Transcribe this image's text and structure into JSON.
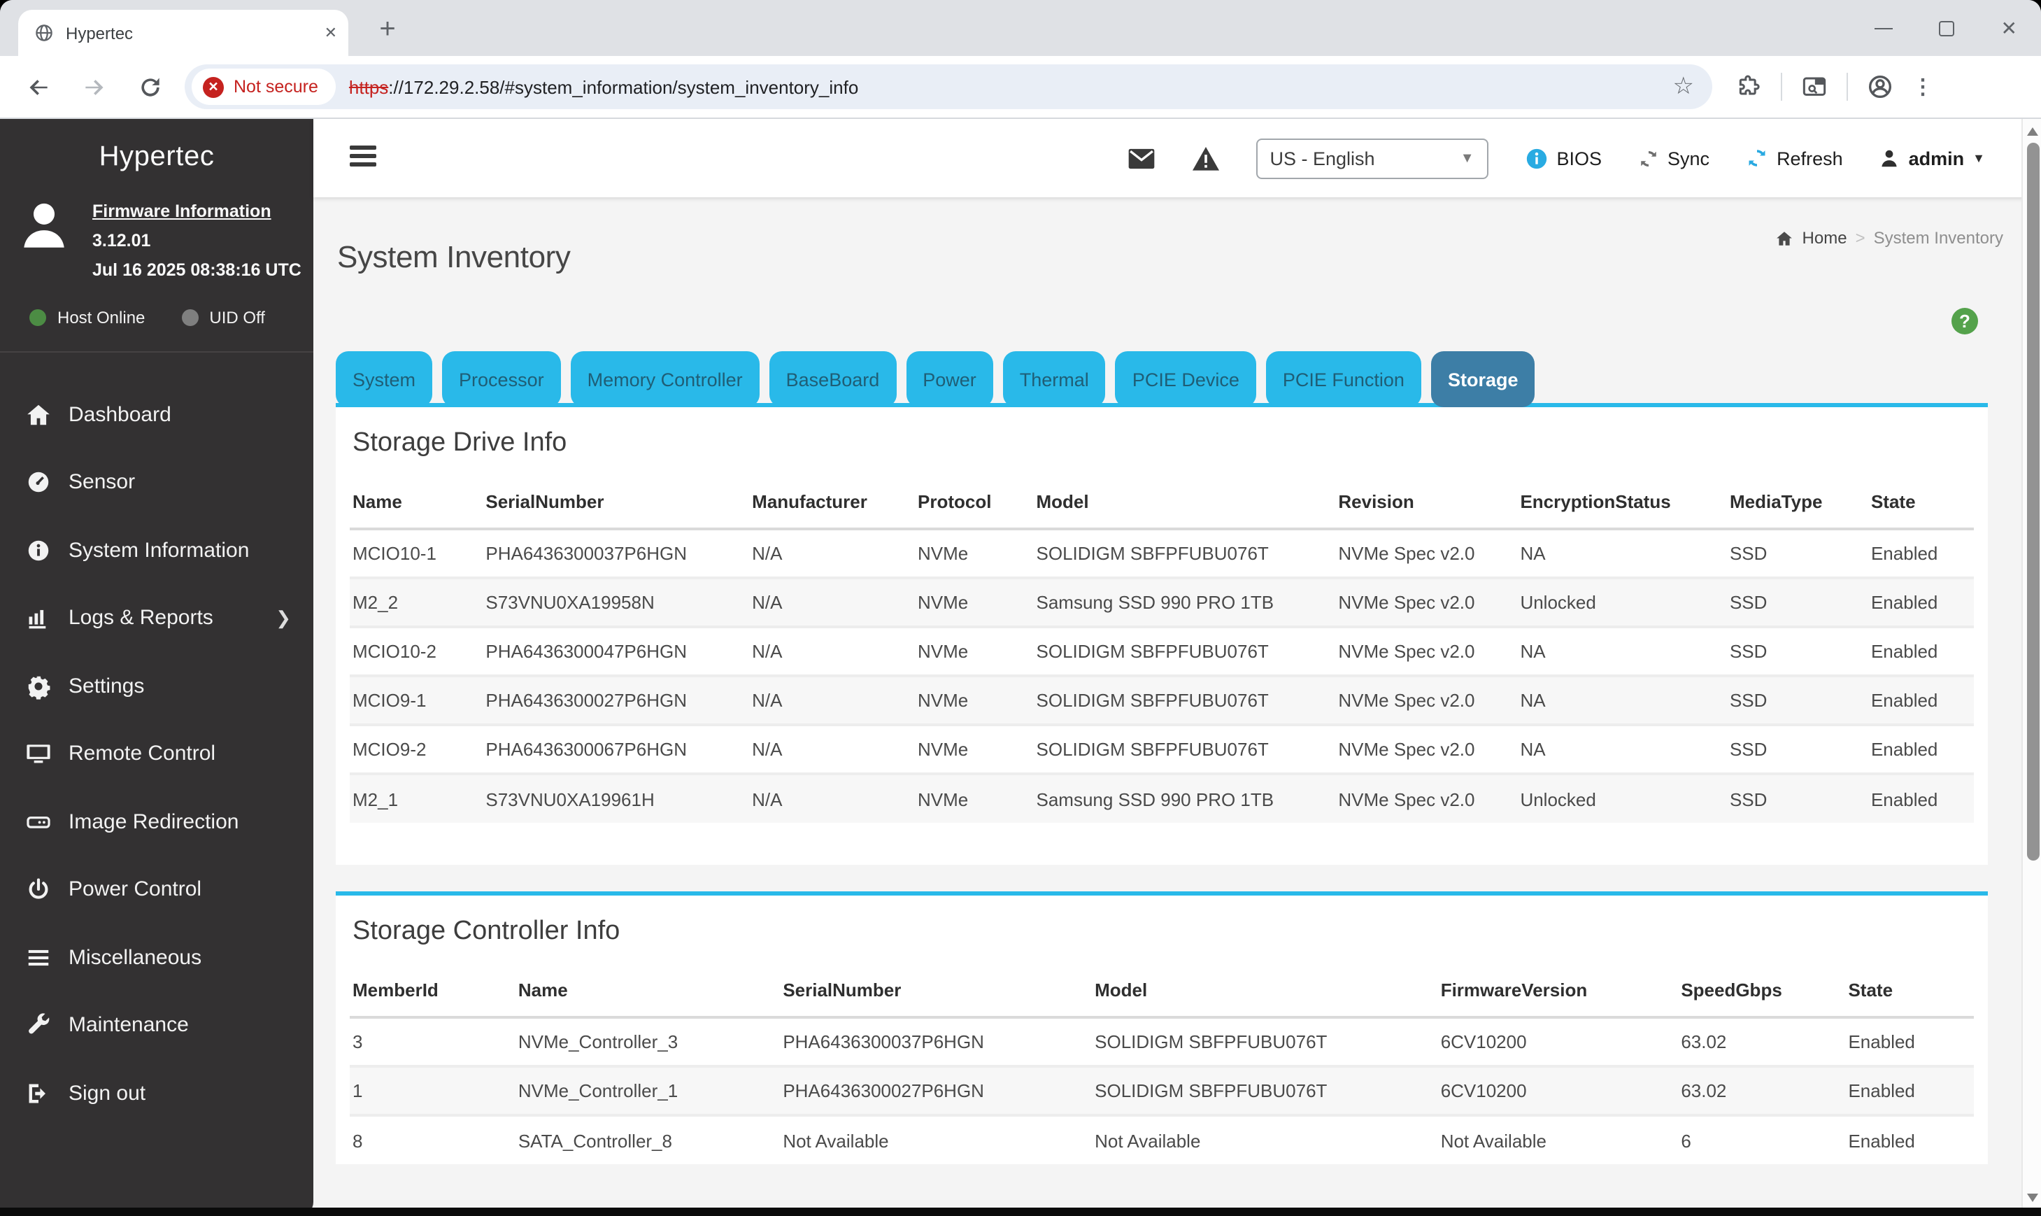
{
  "colors": {
    "accent": "#29B9E9",
    "active_tab": "#3D7EA6",
    "sidebar_bg": "#333132",
    "help_green": "#54A24B",
    "host_online_green": "#4C8C44",
    "uid_off_gray": "#7F7F7F",
    "bios_info_blue": "#29ABE2",
    "refresh_blue": "#29A9E1",
    "sync_gray": "#6E6E6E",
    "not_secure_red": "#C5221F",
    "profile_blue": "#1A73E8"
  },
  "browser": {
    "tab_title": "Hypertec",
    "not_secure_label": "Not secure",
    "url_scheme": "https",
    "url_rest": "://172.29.2.58/#system_information/system_inventory_info"
  },
  "sidebar": {
    "brand": "Hypertec",
    "firmware_link": "Firmware Information",
    "firmware_version": "3.12.01",
    "firmware_date": "Jul 16 2025 08:38:16 UTC",
    "host_status": "Host Online",
    "uid_status": "UID Off",
    "items": [
      {
        "label": "Dashboard",
        "icon": "home"
      },
      {
        "label": "Sensor",
        "icon": "gauge"
      },
      {
        "label": "System Information",
        "icon": "info"
      },
      {
        "label": "Logs & Reports",
        "icon": "chart",
        "has_submenu": true
      },
      {
        "label": "Settings",
        "icon": "gear"
      },
      {
        "label": "Remote Control",
        "icon": "monitor"
      },
      {
        "label": "Image Redirection",
        "icon": "disk"
      },
      {
        "label": "Power Control",
        "icon": "power"
      },
      {
        "label": "Miscellaneous",
        "icon": "menu"
      },
      {
        "label": "Maintenance",
        "icon": "wrench"
      },
      {
        "label": "Sign out",
        "icon": "signout"
      }
    ]
  },
  "header": {
    "language": "US - English",
    "bios_label": "BIOS",
    "sync_label": "Sync",
    "refresh_label": "Refresh",
    "user": "admin"
  },
  "page": {
    "title": "System Inventory",
    "breadcrumb": {
      "home": "Home",
      "separator": ">",
      "current": "System Inventory"
    },
    "tabs": [
      {
        "label": "System"
      },
      {
        "label": "Processor"
      },
      {
        "label": "Memory Controller"
      },
      {
        "label": "BaseBoard"
      },
      {
        "label": "Power"
      },
      {
        "label": "Thermal"
      },
      {
        "label": "PCIE Device"
      },
      {
        "label": "PCIE Function"
      },
      {
        "label": "Storage",
        "active": true
      }
    ],
    "drive_info": {
      "title": "Storage Drive Info",
      "columns": [
        "Name",
        "SerialNumber",
        "Manufacturer",
        "Protocol",
        "Model",
        "Revision",
        "EncryptionStatus",
        "MediaType",
        "State"
      ],
      "rows": [
        [
          "MCIO10-1",
          "PHA6436300037P6HGN",
          "N/A",
          "NVMe",
          "SOLIDIGM SBFPFUBU076T",
          "NVMe Spec v2.0",
          "NA",
          "SSD",
          "Enabled"
        ],
        [
          "M2_2",
          "S73VNU0XA19958N",
          "N/A",
          "NVMe",
          "Samsung SSD 990 PRO 1TB",
          "NVMe Spec v2.0",
          "Unlocked",
          "SSD",
          "Enabled"
        ],
        [
          "MCIO10-2",
          "PHA6436300047P6HGN",
          "N/A",
          "NVMe",
          "SOLIDIGM SBFPFUBU076T",
          "NVMe Spec v2.0",
          "NA",
          "SSD",
          "Enabled"
        ],
        [
          "MCIO9-1",
          "PHA6436300027P6HGN",
          "N/A",
          "NVMe",
          "SOLIDIGM SBFPFUBU076T",
          "NVMe Spec v2.0",
          "NA",
          "SSD",
          "Enabled"
        ],
        [
          "MCIO9-2",
          "PHA6436300067P6HGN",
          "N/A",
          "NVMe",
          "SOLIDIGM SBFPFUBU076T",
          "NVMe Spec v2.0",
          "NA",
          "SSD",
          "Enabled"
        ],
        [
          "M2_1",
          "S73VNU0XA19961H",
          "N/A",
          "NVMe",
          "Samsung SSD 990 PRO 1TB",
          "NVMe Spec v2.0",
          "Unlocked",
          "SSD",
          "Enabled"
        ]
      ]
    },
    "controller_info": {
      "title": "Storage Controller Info",
      "columns": [
        "MemberId",
        "Name",
        "SerialNumber",
        "Model",
        "FirmwareVersion",
        "SpeedGbps",
        "State"
      ],
      "rows": [
        [
          "3",
          "NVMe_Controller_3",
          "PHA6436300037P6HGN",
          "SOLIDIGM SBFPFUBU076T",
          "6CV10200",
          "63.02",
          "Enabled"
        ],
        [
          "1",
          "NVMe_Controller_1",
          "PHA6436300027P6HGN",
          "SOLIDIGM SBFPFUBU076T",
          "6CV10200",
          "63.02",
          "Enabled"
        ],
        [
          "8",
          "SATA_Controller_8",
          "Not Available",
          "Not Available",
          "Not Available",
          "6",
          "Enabled"
        ]
      ]
    }
  }
}
